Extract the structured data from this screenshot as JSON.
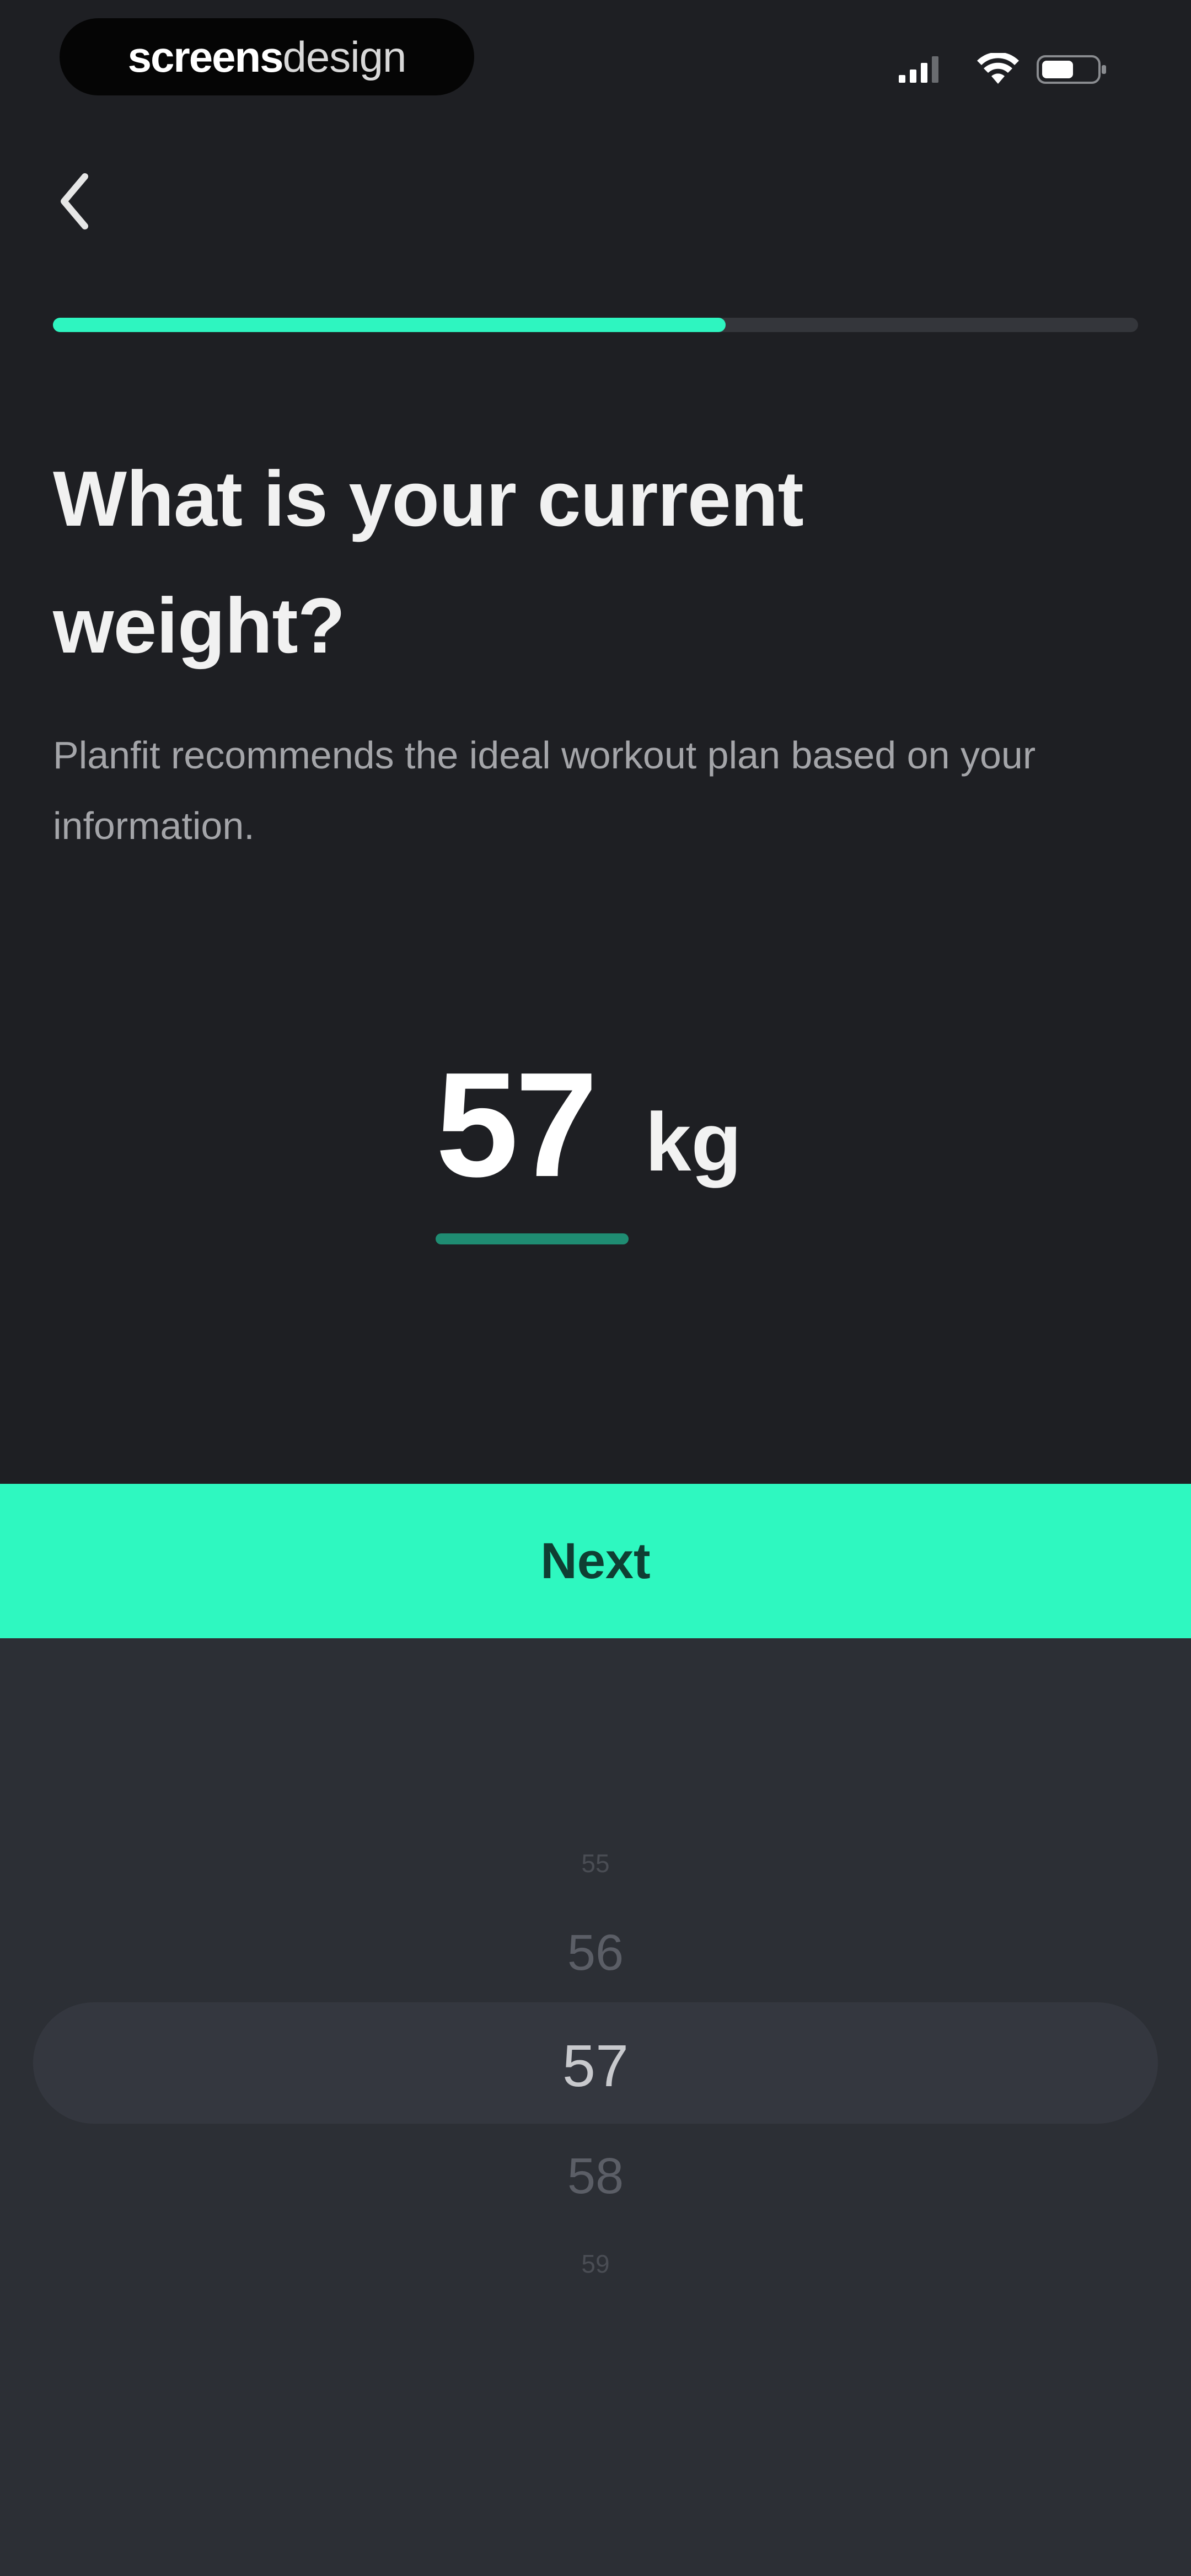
{
  "status_bar": {
    "brand_bold": "screens",
    "brand_light": "design",
    "icons": [
      "signal-icon",
      "wifi-icon",
      "battery-icon"
    ]
  },
  "nav": {
    "back_icon": "chevron-left-icon"
  },
  "progress": {
    "fraction": 0.62,
    "fill_color": "#2ef5c0",
    "track_color": "#34363b"
  },
  "content": {
    "title": "What is your current weight?",
    "subtitle": "Planfit recommends the ideal workout plan based on your information."
  },
  "weight": {
    "value": "57",
    "unit": "kg"
  },
  "actions": {
    "next_label": "Next",
    "next_color": "#2ef8c0"
  },
  "picker": {
    "far_above": "55",
    "above": "56",
    "selected": "57",
    "below": "58",
    "far_below": "59"
  },
  "colors": {
    "background": "#1e1f23",
    "picker_background": "#2c2f35",
    "accent": "#2ef5c0"
  }
}
